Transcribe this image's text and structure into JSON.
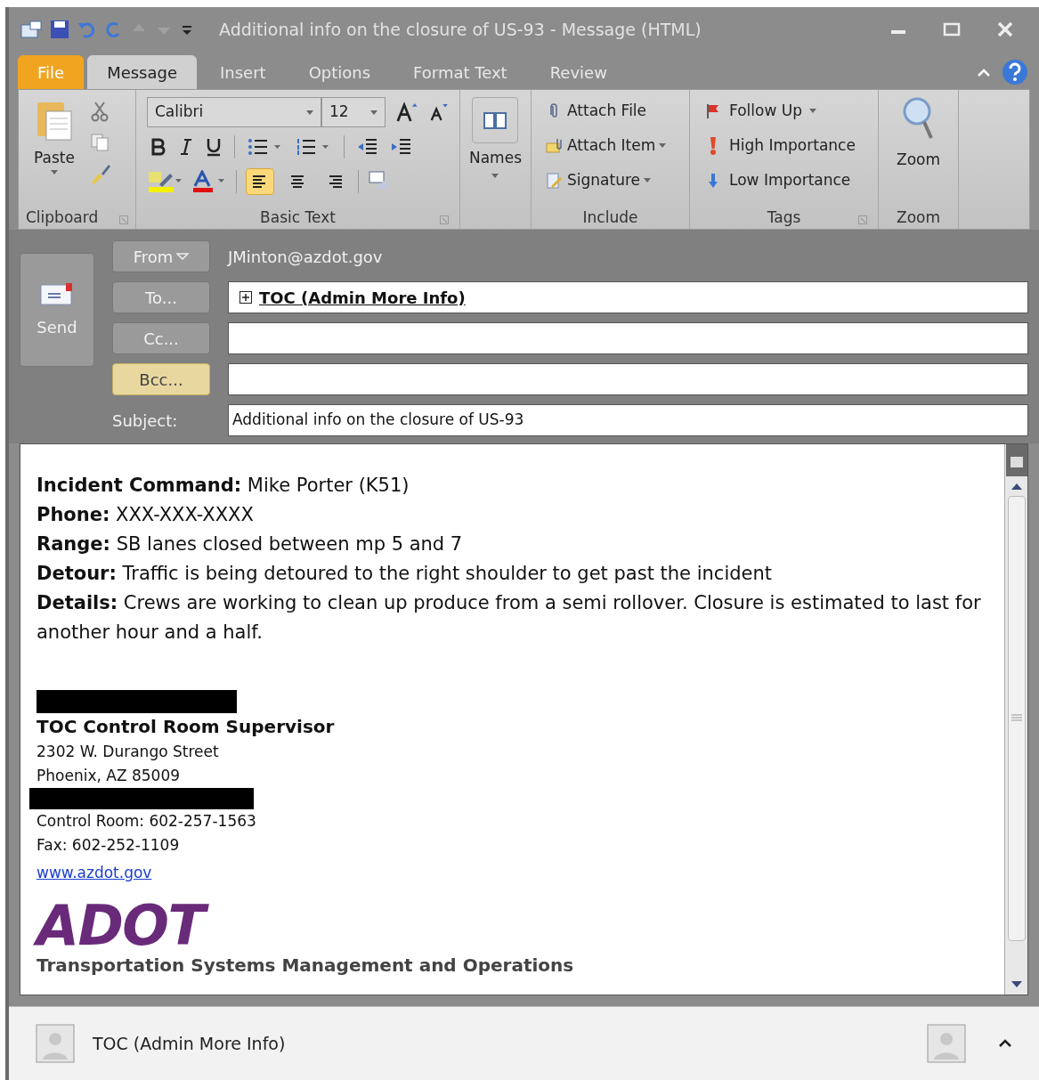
{
  "window": {
    "title": "Additional info on the closure of US-93  -  Message (HTML)"
  },
  "tabs": [
    {
      "label": "File",
      "kind": "file",
      "selected": false
    },
    {
      "label": "Message",
      "kind": "tab",
      "selected": true
    },
    {
      "label": "Insert",
      "kind": "tab",
      "selected": false
    },
    {
      "label": "Options",
      "kind": "tab",
      "selected": false
    },
    {
      "label": "Format Text",
      "kind": "tab",
      "selected": false
    },
    {
      "label": "Review",
      "kind": "tab",
      "selected": false
    }
  ],
  "ribbon": {
    "clipboard": {
      "label": "Clipboard",
      "paste": "Paste"
    },
    "basic_text": {
      "label": "Basic Text",
      "font": "Calibri",
      "size": "12",
      "alignment": [
        {
          "kind": "left",
          "selected": true
        },
        {
          "kind": "center",
          "selected": false
        },
        {
          "kind": "right",
          "selected": false
        }
      ]
    },
    "names": {
      "button": "Names"
    },
    "include": {
      "label": "Include",
      "items": [
        {
          "label": "Attach File",
          "kind": "clip",
          "dropdown": false
        },
        {
          "label": "Attach Item",
          "kind": "envelope",
          "dropdown": true
        },
        {
          "label": "Signature",
          "kind": "signature",
          "dropdown": true
        }
      ]
    },
    "tags": {
      "label": "Tags",
      "items": [
        {
          "label": "Follow Up",
          "kind": "flag",
          "dropdown": true
        },
        {
          "label": "High Importance",
          "kind": "high",
          "dropdown": false
        },
        {
          "label": "Low Importance",
          "kind": "low",
          "dropdown": false
        }
      ]
    },
    "zoom": {
      "label": "Zoom",
      "button": "Zoom"
    }
  },
  "header": {
    "send": "Send",
    "from_button": "From",
    "from_value": "JMinton@azdot.gov",
    "fields": [
      {
        "button": "To...",
        "value": "TOC (Admin More Info)",
        "highlighted": false
      },
      {
        "button": "Cc...",
        "highlighted": false
      },
      {
        "button": "Bcc...",
        "highlighted": true
      }
    ],
    "subject_label": "Subject:",
    "subject": "Additional info on the closure of US-93"
  },
  "body": {
    "lines": [
      "**Incident Command:** Mike Porter (K51)",
      "**Phone:** XXX-XXX-XXXX",
      "**Range:** SB lanes closed between mp 5 and 7",
      "**Detour:** Traffic is being detoured to the right shoulder to get past the incident",
      "**Details:** Crews are working to clean up produce from a semi rollover. Closure is estimated to last for another hour and a half."
    ],
    "signature": {
      "title": "TOC Control Room Supervisor",
      "address": [
        "2302 W. Durango Street",
        "Phoenix, AZ 85009"
      ],
      "contacts": [
        "Control Room: 602-257-1563",
        "Fax: 602-252-1109"
      ],
      "link": "www.azdot.gov",
      "logo": "ADOT",
      "tagline": "Transportation Systems Management and Operations"
    }
  },
  "people_pane": {
    "name": "TOC (Admin More Info)"
  }
}
